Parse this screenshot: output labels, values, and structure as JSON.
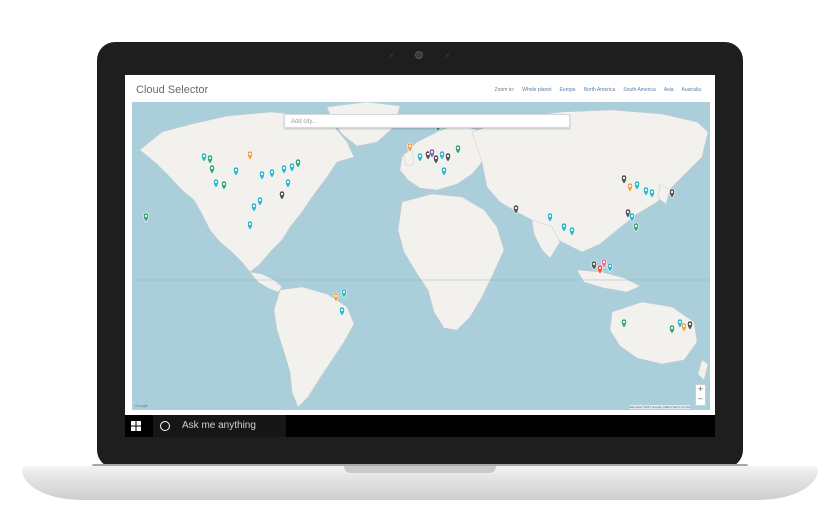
{
  "app": {
    "title": "Cloud Selector"
  },
  "zoom_nav": {
    "label": "Zoom to:",
    "links": [
      "Whole planet",
      "Europe",
      "North America",
      "South America",
      "Asia",
      "Australia"
    ]
  },
  "search": {
    "placeholder": "Add city..."
  },
  "map": {
    "zoom_in": "+",
    "zoom_out": "−",
    "attribution": "Map data ©2017 Google, INEGI  Terms of Use",
    "provider": "Google",
    "colors": {
      "water": "#aacfdb",
      "land": "#f2f1ee",
      "pin_green": "#3aa57a",
      "pin_teal": "#2fb8c9",
      "pin_gray": "#555555",
      "pin_orange": "#f0a24a",
      "pin_red": "#e8503a",
      "pin_pink": "#e36fa3",
      "pin_purple": "#8e5bb5"
    }
  },
  "taskbar": {
    "start_icon": "windows-logo-icon",
    "cortana_icon": "cortana-circle-icon",
    "search_text": "Ask me anything"
  }
}
